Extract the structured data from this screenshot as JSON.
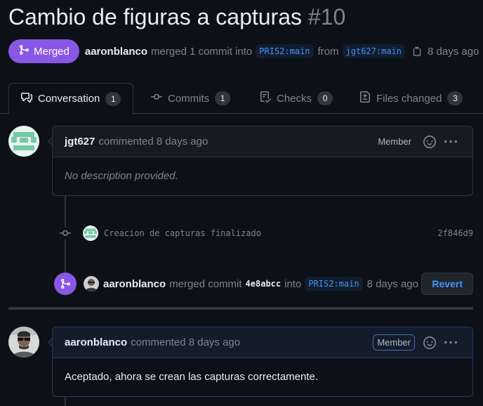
{
  "pr": {
    "title": "Cambio de figuras a capturas",
    "number": "#10",
    "state": "Merged",
    "author": "aaronblanco",
    "action": "merged 1 commit into",
    "base_branch": "PRIS2:main",
    "from_word": "from",
    "head_branch": "jgt627:main",
    "time": "8 days ago"
  },
  "tabs": [
    {
      "label": "Conversation",
      "count": "1",
      "icon": "comment-discussion-icon"
    },
    {
      "label": "Commits",
      "count": "1",
      "icon": "git-commit-icon"
    },
    {
      "label": "Checks",
      "count": "0",
      "icon": "checklist-icon"
    },
    {
      "label": "Files changed",
      "count": "3",
      "icon": "file-diff-icon"
    }
  ],
  "timeline": {
    "first_comment": {
      "author": "jgt627",
      "meta": "commented 8 days ago",
      "role": "Member",
      "body": "No description provided."
    },
    "commit": {
      "message": "Creacion de capturas finalizado",
      "sha": "2f846d9"
    },
    "merge_event": {
      "user": "aaronblanco",
      "action": "merged commit",
      "sha": "4e8abcc",
      "into": "into",
      "branch": "PRIS2:main",
      "time": "8 days ago",
      "revert_label": "Revert"
    },
    "second_comment": {
      "author": "aaronblanco",
      "meta": "commented 8 days ago",
      "role": "Member",
      "body": "Aceptado, ahora se crean las capturas correctamente."
    }
  },
  "colors": {
    "merged_purple": "#8957e5",
    "link_blue": "#4493f8",
    "bg": "#0d1117"
  }
}
